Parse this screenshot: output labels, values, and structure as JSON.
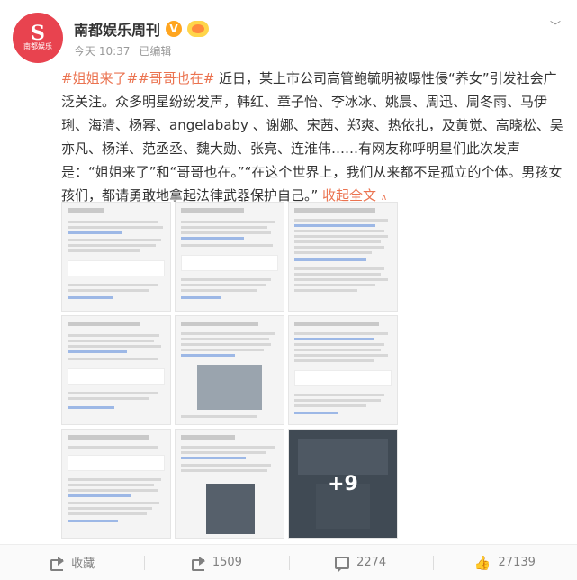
{
  "author": {
    "name": "南都娱乐周刊",
    "avatar_text": "南都娱乐",
    "verified_badge": "V",
    "time": "今天 10:37",
    "edited": "已编辑"
  },
  "post": {
    "topic1": "#姐姐来了#",
    "topic2": "#哥哥也在#",
    "body": " 近日，某上市公司高管鲍毓明被曝性侵“养女”引发社会广泛关注。众多明星纷纷发声，韩红、章子怡、李冰冰、姚晨、周迅、周冬雨、马伊琍、海清、杨幂、angelababy 、谢娜、宋茜、郑爽、热依扎，及黄觉、高晓松、吴亦凡、杨洋、范丞丞、魏大勋、张亮、连淮伟……有网友称呼明星们此次发声是：“姐姐来了”和“哥哥也在。”“在这个世界上，我们从来都不是孤立的个体。男孩女孩们，都请勇敢地拿起法律武器保护自己。” ",
    "collapse_label": "收起全文",
    "collapse_chevron": "∧"
  },
  "gallery": {
    "extra_count": "+9"
  },
  "actions": {
    "share_label": "收藏",
    "comment_count": "1509",
    "repost_count": "2274",
    "like_count": "27139"
  },
  "colors": {
    "accent": "#eb7350",
    "avatar_bg": "#e8434f",
    "badge": "#ffa51f"
  }
}
